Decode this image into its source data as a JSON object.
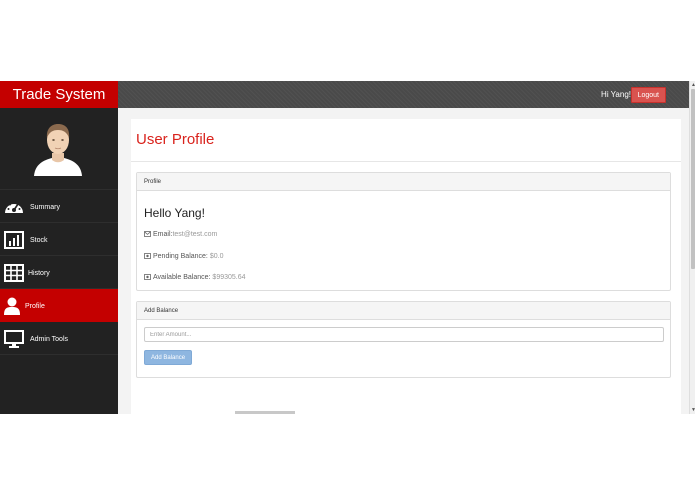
{
  "header": {
    "brand": "Trade System",
    "greeting": "Hi Yang!",
    "logout_label": "Logout"
  },
  "sidebar": {
    "items": [
      {
        "label": "Summary",
        "icon": "dashboard-icon",
        "active": false
      },
      {
        "label": "Stock",
        "icon": "bar-chart-icon",
        "active": false
      },
      {
        "label": "History",
        "icon": "table-icon",
        "active": false
      },
      {
        "label": "Profile",
        "icon": "user-icon",
        "active": true
      },
      {
        "label": "Admin Tools",
        "icon": "monitor-icon",
        "active": false
      }
    ]
  },
  "main": {
    "title": "User Profile",
    "profile_panel": {
      "heading": "Profile",
      "hello": "Hello Yang!",
      "email_label": "Email:",
      "email_value": "test@test.com",
      "pending_label": "Pending Balance:",
      "pending_value": "$0.0",
      "available_label": "Available Balance:",
      "available_value": "$99305.64"
    },
    "balance_panel": {
      "heading": "Add Balance",
      "amount_placeholder": "Enter Amount...",
      "button_label": "Add Balance"
    }
  },
  "colors": {
    "brand_red": "#c40000",
    "title_red": "#d9231d",
    "logout_red": "#d9534f",
    "button_blue": "#8eb6e0",
    "sidebar_bg": "#222222",
    "topbar_bg": "#4a4a4a"
  }
}
